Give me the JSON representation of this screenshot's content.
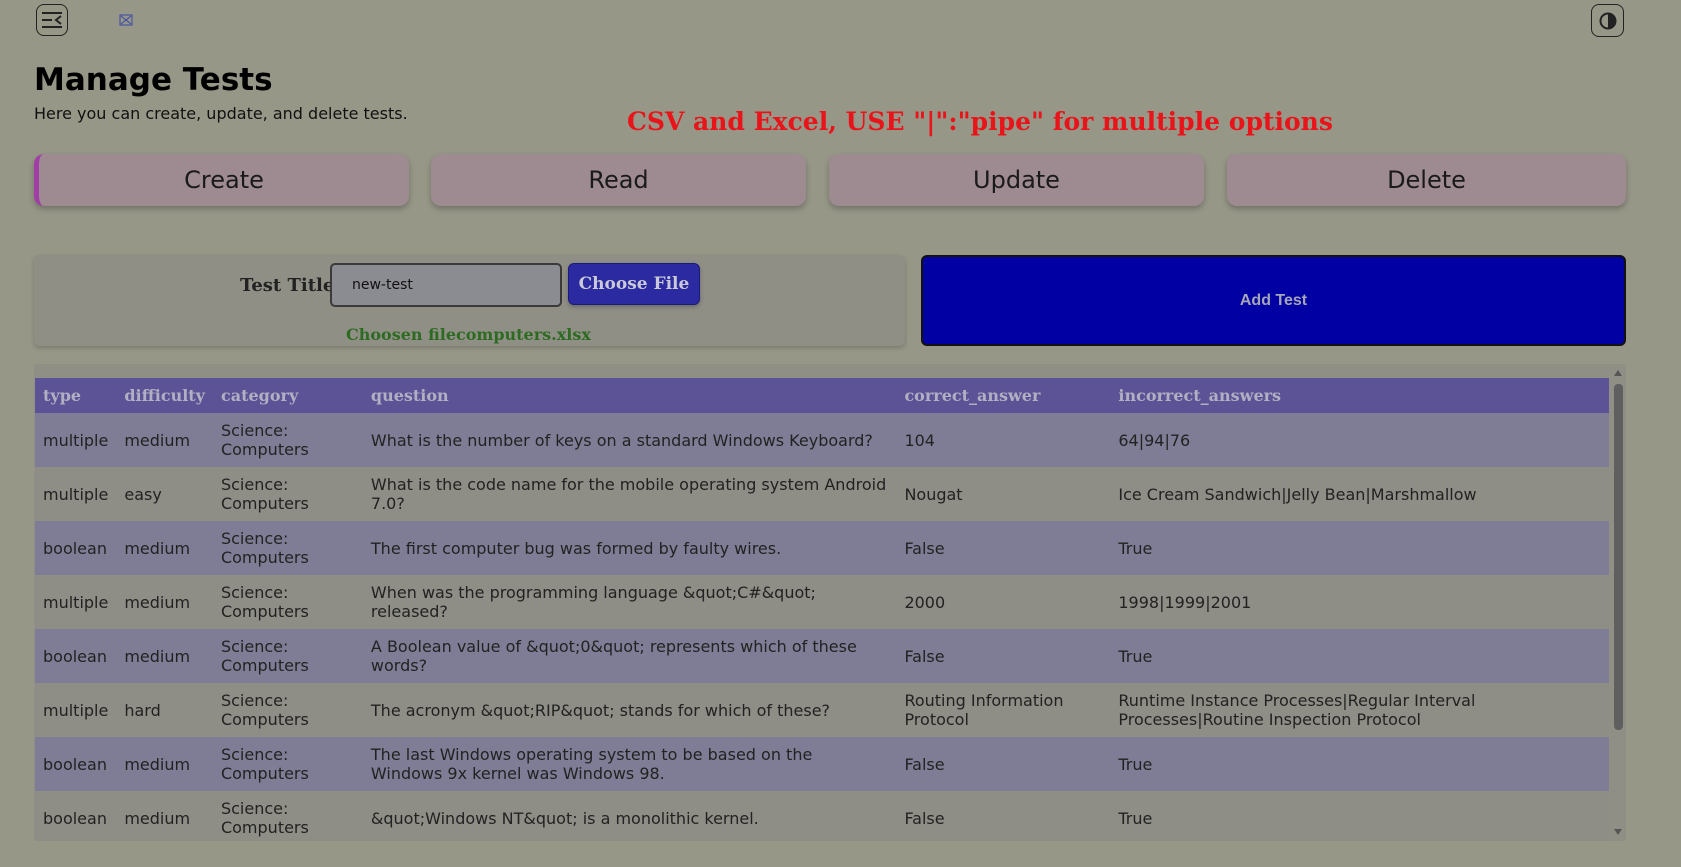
{
  "page": {
    "title": "Manage Tests",
    "subtitle": "Here you can create, update, and delete tests.",
    "notice": "CSV and Excel, USE \"|\":\"pipe\" for multiple options"
  },
  "icons": {
    "menu": "menu-collapse-icon",
    "logo": "broken-image-icon",
    "theme": "contrast-icon"
  },
  "tabs": [
    {
      "label": "Create",
      "active": true
    },
    {
      "label": "Read",
      "active": false
    },
    {
      "label": "Update",
      "active": false
    },
    {
      "label": "Delete",
      "active": false
    }
  ],
  "form": {
    "title_label": "Test Title",
    "title_value": "new-test",
    "choose_file_label": "Choose File",
    "chosen_file": "Choosen filecomputers.xlsx",
    "add_button": "Add Test"
  },
  "table": {
    "columns": [
      "type",
      "difficulty",
      "category",
      "question",
      "correct_answer",
      "incorrect_answers"
    ],
    "rows": [
      [
        "multiple",
        "medium",
        "Science: Computers",
        "What is the number of keys on a standard Windows Keyboard?",
        "104",
        "64|94|76"
      ],
      [
        "multiple",
        "easy",
        "Science: Computers",
        "What is the code name for the mobile operating system Android 7.0?",
        "Nougat",
        "Ice Cream Sandwich|Jelly Bean|Marshmallow"
      ],
      [
        "boolean",
        "medium",
        "Science: Computers",
        "The first computer bug was formed by faulty wires.",
        "False",
        "True"
      ],
      [
        "multiple",
        "medium",
        "Science: Computers",
        "When was the programming language &quot;C#&quot; released?",
        "2000",
        "1998|1999|2001"
      ],
      [
        "boolean",
        "medium",
        "Science: Computers",
        "A Boolean value of &quot;0&quot; represents which of these words?",
        "False",
        "True"
      ],
      [
        "multiple",
        "hard",
        "Science: Computers",
        "The acronym &quot;RIP&quot; stands for which of these?",
        "Routing Information Protocol",
        "Runtime Instance Processes|Regular Interval Processes|Routine Inspection Protocol"
      ],
      [
        "boolean",
        "medium",
        "Science: Computers",
        "The last Windows operating system to be based on the Windows 9x kernel was Windows 98.",
        "False",
        "True"
      ],
      [
        "boolean",
        "medium",
        "Science: Computers",
        "&quot;Windows NT&quot; is a monolithic kernel.",
        "False",
        "True"
      ]
    ]
  },
  "colors": {
    "background": "#979788",
    "tab": "#9e8b92",
    "active_tab_accent": "#a13ea6",
    "notice": "#e8141a",
    "add_button": "#0000a3",
    "choose_button": "#2b2aa0",
    "table_header": "#5b5396",
    "chosen_file": "#2e6b22"
  }
}
